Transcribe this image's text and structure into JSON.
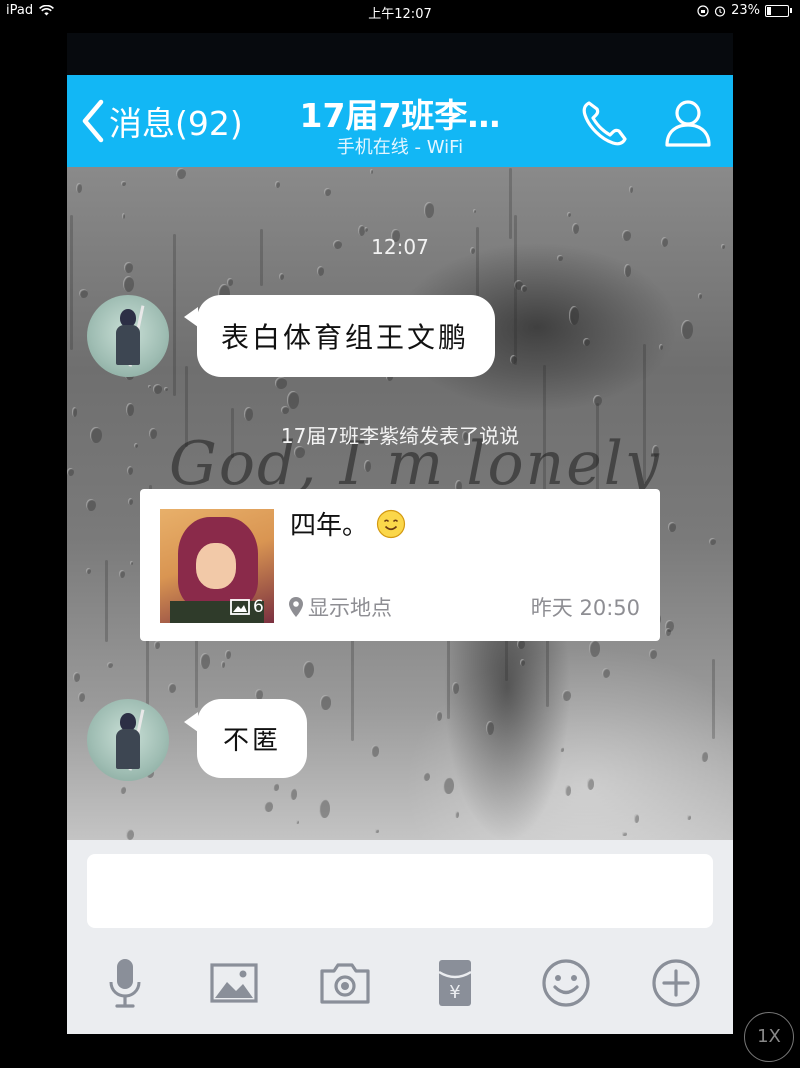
{
  "status_bar": {
    "device": "iPad",
    "time": "上午12:07",
    "battery": "23%",
    "battery_level": 0.23
  },
  "header": {
    "back_label": "消息(92)",
    "title": "17届7班李…",
    "subtitle": "手机在线 - WiFi",
    "accent_color": "#12b7f5"
  },
  "chat": {
    "timestamp": "12:07",
    "wallpaper_text": "God, I m lonely",
    "messages": [
      {
        "text": "表白体育组王文鹏"
      },
      {
        "text": "不匿"
      }
    ],
    "system_notice": "17届7班李紫绮发表了说说",
    "shared_post": {
      "text": "四年。",
      "image_count": "6",
      "location": "显示地点",
      "time": "昨天 20:50"
    }
  },
  "toolbar": {
    "icons": [
      "microphone-icon",
      "picture-icon",
      "camera-icon",
      "red-packet-icon",
      "emoji-icon",
      "plus-icon"
    ],
    "red_packet_glyph": "¥"
  },
  "zoom": "1X"
}
